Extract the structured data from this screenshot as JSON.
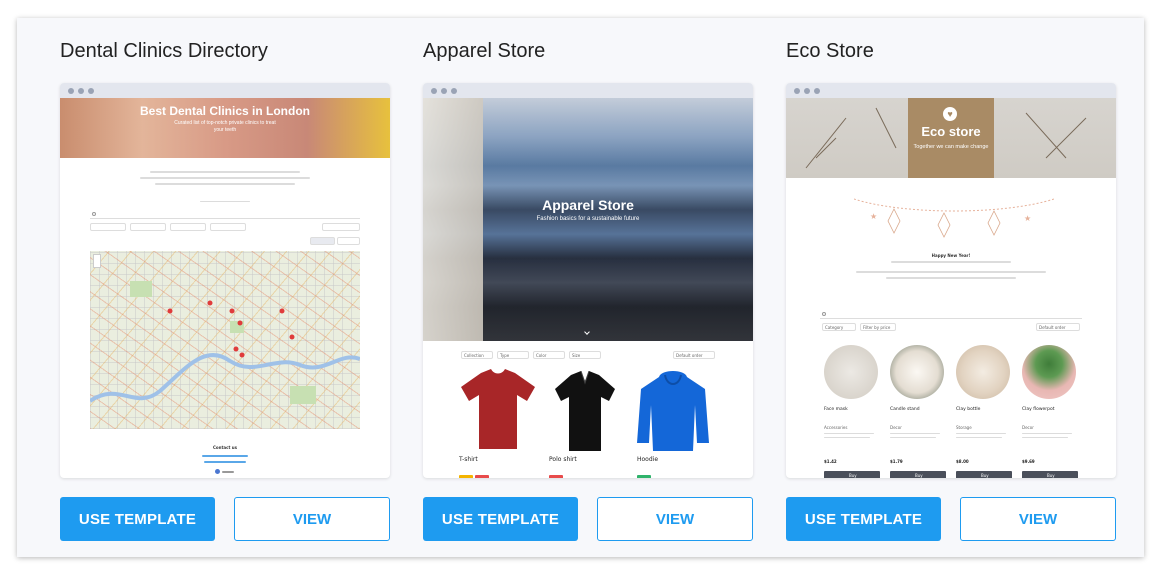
{
  "cards": [
    {
      "title": "Dental Clinics Directory",
      "preview": {
        "hero_title": "Best Dental Clinics in London",
        "hero_subtitle": "Curated list of top-notch private clinics to treat your teeth",
        "contact_heading": "Contact us"
      },
      "use_label": "USE TEMPLATE",
      "view_label": "VIEW"
    },
    {
      "title": "Apparel Store",
      "preview": {
        "hero_title": "Apparel Store",
        "hero_subtitle": "Fashion basics for a sustainable future",
        "filters": [
          "Collection",
          "Type",
          "Color",
          "Size"
        ],
        "sort": "Default order",
        "products": [
          "T-shirt",
          "Polo shirt",
          "Hoodie"
        ],
        "product_colors": [
          "#a82628",
          "#111111",
          "#1467d8"
        ]
      },
      "use_label": "USE TEMPLATE",
      "view_label": "VIEW"
    },
    {
      "title": "Eco Store",
      "preview": {
        "hero_title": "Eco store",
        "hero_subtitle": "Together we can make change",
        "announcement": "Happy New Year!",
        "filters": [
          "Category",
          "Filter by price"
        ],
        "sort": "Default order",
        "products": [
          {
            "name": "Face mask",
            "category": "Accessories",
            "price": "$1.42"
          },
          {
            "name": "Candle stand",
            "category": "Decor",
            "price": "$1.79"
          },
          {
            "name": "Clay bottle",
            "category": "Storage",
            "price": "$8.00"
          },
          {
            "name": "Clay flowerpot",
            "category": "Decor",
            "price": "$9.69"
          }
        ],
        "buy_label": "Buy"
      },
      "use_label": "USE TEMPLATE",
      "view_label": "VIEW"
    }
  ],
  "colors": {
    "accent": "#1e9bf0",
    "chrome": "#e3e6ee"
  }
}
